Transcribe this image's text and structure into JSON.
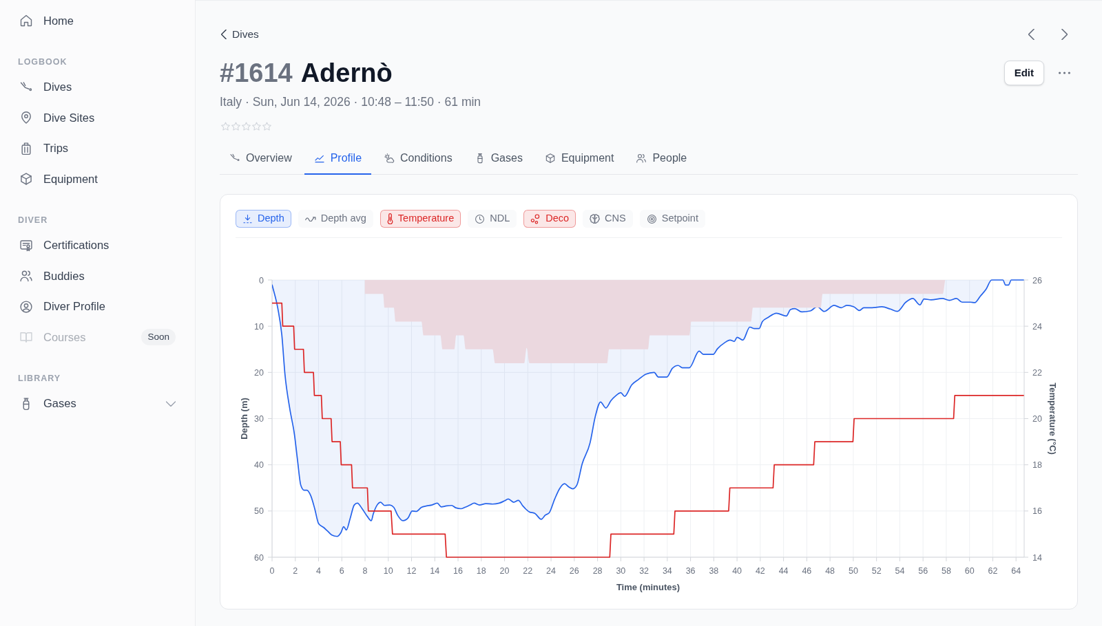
{
  "sidebar": {
    "sections": [
      {
        "items": [
          {
            "label": "Home",
            "disabled": false
          }
        ]
      },
      {
        "title": "LOGBOOK",
        "items": [
          {
            "label": "Dives",
            "disabled": false
          },
          {
            "label": "Dive Sites",
            "disabled": false
          },
          {
            "label": "Trips",
            "disabled": false
          },
          {
            "label": "Equipment",
            "disabled": false
          }
        ]
      },
      {
        "title": "DIVER",
        "items": [
          {
            "label": "Certifications",
            "disabled": false
          },
          {
            "label": "Buddies",
            "disabled": false
          },
          {
            "label": "Diver Profile",
            "disabled": false
          },
          {
            "label": "Courses",
            "disabled": true,
            "badge": "Soon"
          }
        ]
      },
      {
        "title": "LIBRARY",
        "items": [
          {
            "label": "Gases",
            "disabled": false,
            "expanded": false
          }
        ]
      }
    ]
  },
  "breadcrumb": {
    "label": "Dives"
  },
  "dive": {
    "number": "#1614",
    "site": "Adernò",
    "summary": "Italy · Sun, Jun 14, 2026 · 10:48 – 11:50 · 61 min",
    "stars": 0
  },
  "actions": {
    "edit": "Edit"
  },
  "tabs": [
    {
      "label": "Overview",
      "selected": false
    },
    {
      "label": "Profile",
      "selected": true
    },
    {
      "label": "Conditions",
      "selected": false
    },
    {
      "label": "Gases",
      "selected": false
    },
    {
      "label": "Equipment",
      "selected": false
    },
    {
      "label": "People",
      "selected": false
    }
  ],
  "profile": {
    "toggles": [
      {
        "label": "Depth",
        "selected": true,
        "color": "#2563eb"
      },
      {
        "label": "Depth avg",
        "selected": false
      },
      {
        "label": "Temperature",
        "selected": true,
        "color": "#dc2626"
      },
      {
        "label": "NDL",
        "selected": false
      },
      {
        "label": "Deco",
        "selected": true,
        "color": "#dc2626"
      },
      {
        "label": "CNS",
        "selected": false
      },
      {
        "label": "Setpoint",
        "selected": false
      }
    ],
    "chart_data": {
      "type": "line",
      "xlabel": "Time (minutes)",
      "ylabel": "Depth (m)",
      "y2label": "Temperature (°C)",
      "grid": true,
      "xlim": [
        0,
        64.7
      ],
      "ylim": [
        60,
        0
      ],
      "y2lim": [
        14,
        26
      ],
      "xticks": [
        0,
        2,
        4,
        6,
        8,
        10,
        12,
        14,
        16,
        18,
        20,
        22,
        24,
        26,
        28,
        30,
        32,
        34,
        36,
        38,
        40,
        42,
        44,
        46,
        48,
        50,
        52,
        54,
        56,
        58,
        60,
        62,
        64
      ],
      "yticks": [
        0,
        10,
        20,
        30,
        40,
        50,
        60
      ],
      "y2ticks": [
        14,
        16,
        18,
        20,
        22,
        24,
        26
      ],
      "series": [
        {
          "type": "area",
          "color": "#2563eb",
          "x": [
            0,
            0.5,
            0.84,
            1.11,
            1.52,
            1.93,
            2.2,
            2.47,
            2.76,
            3.0,
            3.33,
            3.67,
            4.0,
            4.46,
            4.8,
            5.14,
            5.6,
            5.94,
            6.16,
            6.39,
            6.73,
            7.07,
            7.34,
            7.75,
            8.2,
            8.54,
            8.7,
            9.04,
            9.34,
            9.68,
            10.13,
            10.47,
            10.8,
            11.26,
            11.7,
            12.05,
            12.4,
            12.85,
            13.3,
            13.75,
            14.21,
            14.55,
            15.0,
            15.45,
            15.8,
            16.25,
            16.59,
            17.04,
            17.38,
            17.84,
            18.4,
            18.97,
            19.54,
            20.0,
            20.32,
            20.78,
            21.19,
            21.57,
            22.14,
            22.6,
            23.16,
            23.5,
            23.84,
            24.3,
            24.75,
            25.16,
            25.54,
            25.88,
            26.22,
            26.68,
            27.35,
            27.81,
            28.26,
            28.71,
            29.16,
            29.6,
            30.0,
            30.33,
            30.94,
            31.54,
            32.15,
            32.87,
            33.23,
            33.96,
            34.44,
            34.93,
            35.29,
            35.89,
            36.74,
            37.1,
            37.95,
            38.31,
            38.92,
            39.4,
            39.76,
            40.0,
            40.5,
            41.1,
            41.46,
            41.9,
            42.18,
            42.67,
            43.39,
            44.24,
            44.6,
            44.97,
            45.57,
            46.3,
            46.9,
            47.5,
            48.35,
            48.96,
            49.44,
            50.05,
            50.53,
            50.9,
            51.62,
            52.46,
            53.19,
            53.79,
            54.52,
            55.12,
            55.73,
            56.09,
            56.7,
            57.66,
            58.27,
            58.87,
            59.36,
            60.08,
            60.45,
            60.93,
            61.42,
            61.9,
            62.87,
            63.1,
            63.35,
            63.59,
            64.68
          ],
          "values": [
            1.0,
            6.2,
            11.9,
            20.4,
            27.8,
            33.5,
            39.2,
            44.4,
            45.5,
            45.5,
            46.7,
            49.5,
            52.7,
            53.6,
            54.4,
            55.2,
            55.5,
            54.6,
            53.4,
            54.1,
            51.5,
            48.7,
            48.3,
            49.5,
            51.2,
            52.1,
            50.7,
            48.7,
            48.1,
            48.8,
            48.7,
            49.2,
            50.9,
            52.1,
            51.5,
            50.0,
            50.1,
            49.2,
            48.9,
            48.7,
            48.3,
            49.1,
            48.9,
            48.8,
            49.3,
            49.5,
            49.2,
            48.7,
            48.3,
            48.7,
            48.4,
            48.5,
            48.3,
            47.8,
            47.4,
            48.1,
            47.7,
            48.9,
            50.2,
            50.5,
            51.8,
            50.9,
            50.4,
            47.5,
            45.1,
            44.1,
            44.8,
            45.2,
            44.4,
            39.8,
            35.3,
            29.5,
            26.4,
            27.7,
            26.1,
            25.0,
            24.4,
            25.2,
            22.7,
            21.5,
            20.4,
            20.0,
            21.0,
            21.0,
            19.1,
            18.5,
            19.0,
            19.0,
            15.4,
            16.1,
            16.1,
            14.9,
            13.6,
            13.0,
            13.3,
            12.4,
            13.0,
            10.2,
            10.5,
            10.5,
            9.0,
            8.1,
            7.2,
            7.8,
            6.4,
            6.2,
            6.9,
            6.7,
            5.8,
            6.8,
            5.5,
            6.0,
            5.5,
            5.8,
            6.6,
            6.0,
            6.0,
            5.8,
            6.3,
            6.8,
            4.8,
            4.0,
            5.4,
            4.1,
            4.3,
            4.0,
            4.4,
            4.0,
            4.8,
            4.8,
            4.9,
            3.5,
            2.0,
            0.0,
            0.0,
            1.1,
            1.1,
            0.0,
            0.0
          ]
        },
        {
          "type": "line",
          "axis": "y2",
          "color": "#dc2626",
          "x": [
            0,
            0.84,
            0.92,
            1.86,
            1.94,
            2.7,
            2.78,
            3.56,
            3.64,
            4.24,
            4.32,
            5.08,
            5.16,
            5.87,
            5.95,
            6.84,
            6.92,
            8.2,
            8.28,
            10.24,
            10.36,
            14.89,
            15.0,
            29.05,
            29.15,
            34.56,
            34.66,
            39.28,
            39.38,
            43.1,
            43.2,
            46.59,
            46.69,
            49.97,
            50.07,
            58.63,
            58.73,
            64.68
          ],
          "values": [
            25,
            25,
            24,
            24,
            23,
            23,
            22,
            22,
            21,
            21,
            20,
            20,
            19,
            19,
            18,
            18,
            17,
            17,
            16,
            16,
            15,
            15,
            14,
            14,
            15,
            15,
            16,
            16,
            17,
            17,
            18,
            18,
            19,
            19,
            20,
            20,
            21,
            21
          ]
        },
        {
          "type": "area",
          "color": "#ebd8df",
          "x": [
            7.98,
            9.55,
            9.68,
            10.47,
            10.62,
            12.85,
            13.03,
            14.48,
            14.66,
            15.68,
            15.84,
            16.47,
            16.66,
            18.97,
            19.19,
            21.69,
            21.9,
            22.14,
            28.82,
            28.99,
            32.34,
            32.5,
            35.9,
            36.06,
            41.2,
            41.36,
            47.2,
            47.36,
            57.7,
            57.9
          ],
          "values": [
            3,
            3,
            6,
            6,
            9,
            9,
            12,
            12,
            15,
            15,
            12,
            12,
            15,
            15,
            18,
            18,
            14.7,
            18,
            18,
            15,
            15,
            12,
            12,
            9,
            9,
            6,
            6,
            3,
            3,
            0
          ]
        }
      ]
    }
  }
}
